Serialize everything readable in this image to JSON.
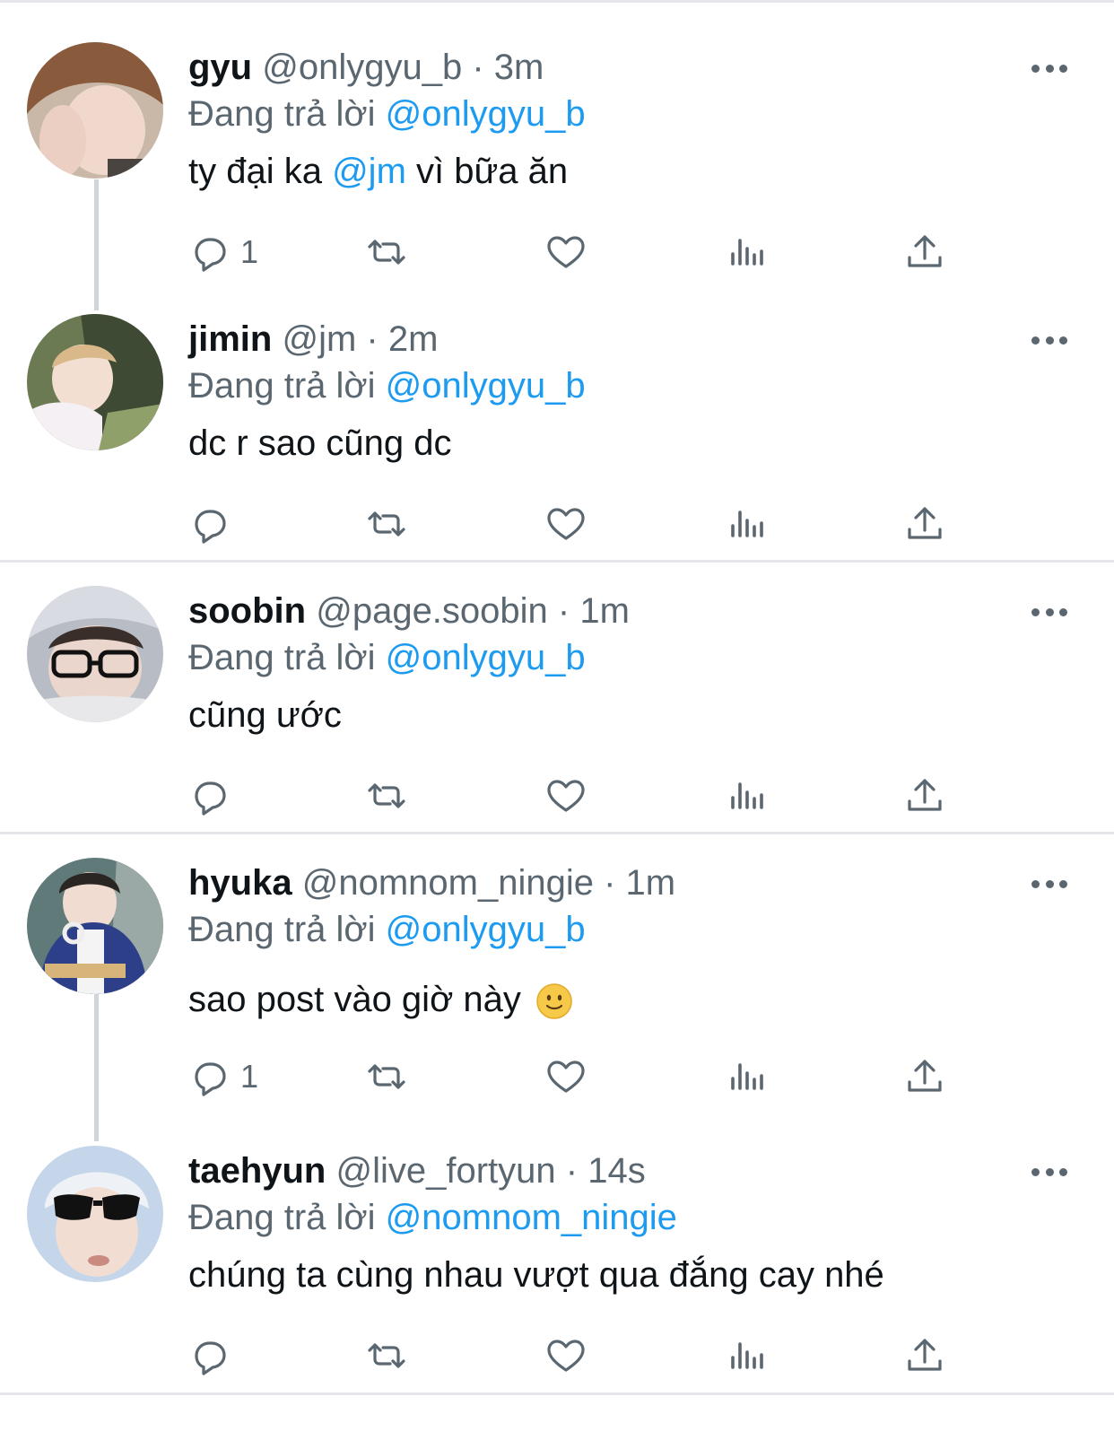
{
  "labels": {
    "more_icon": "more-horizontal-icon",
    "reply_icon": "reply-bubble-icon",
    "retweet_icon": "retweet-icon",
    "like_icon": "heart-icon",
    "views_icon": "views-bar-chart-icon",
    "share_icon": "share-upload-icon"
  },
  "colors": {
    "mention": "#1d9bf0",
    "muted": "#5b6770",
    "text": "#0f1419",
    "divider": "#e4e6e9"
  },
  "tweets": [
    {
      "name": "gyu",
      "handle": "@onlygyu_b",
      "dot": "·",
      "time": "3m",
      "reply_prefix": "Đang trả lời",
      "reply_to": "@onlygyu_b",
      "text_before": "ty đại ka ",
      "text_mention": "@jm",
      "text_after": " vì bữa ăn",
      "reply_count": "1"
    },
    {
      "name": "jimin",
      "handle": "@jm",
      "dot": "·",
      "time": "2m",
      "reply_prefix": "Đang trả lời",
      "reply_to": "@onlygyu_b",
      "text": "dc r sao cũng dc",
      "reply_count": ""
    },
    {
      "name": "soobin",
      "handle": "@page.soobin",
      "dot": "·",
      "time": "1m",
      "reply_prefix": "Đang trả lời",
      "reply_to": "@onlygyu_b",
      "text": "cũng ước",
      "reply_count": ""
    },
    {
      "name": "hyuka",
      "handle": "@nomnom_ningie",
      "dot": "·",
      "time": "1m",
      "reply_prefix": "Đang trả lời",
      "reply_to": "@onlygyu_b",
      "text": "sao post vào giờ này",
      "emoji": "slightly-smiling-face",
      "reply_count": "1"
    },
    {
      "name": "taehyun",
      "handle": "@live_fortyun",
      "dot": "·",
      "time": "14s",
      "reply_prefix": "Đang trả lời",
      "reply_to": "@nomnom_ningie",
      "text": "chúng ta cùng nhau vượt qua đắng cay nhé",
      "reply_count": ""
    }
  ]
}
